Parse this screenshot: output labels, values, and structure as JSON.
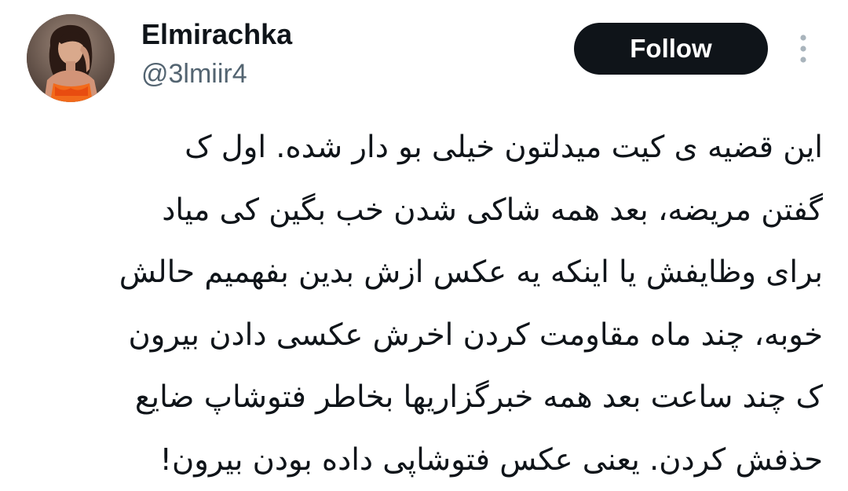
{
  "author": {
    "display_name": "Elmirachka",
    "handle": "@3lmiir4"
  },
  "actions": {
    "follow_label": "Follow",
    "more_icon": "more-vertical-icon"
  },
  "tweet": {
    "lines": [
      "این قضیه ی کیت میدلتون خیلی بو دار شده. اول ک",
      "گفتن مریضه، بعد همه شاکی شدن خب بگین کی میاد",
      "برای وظایفش یا اینکه یه عکس ازش بدین بفهمیم حالش",
      "خوبه، چند ماه مقاومت کردن اخرش عکسی دادن بیرون",
      "ک چند ساعت بعد همه خبرگزاریها بخاطر فتوشاپ ضایع",
      "حذفش کردن. یعنی عکس فتوشاپی داده بودن بیرون!"
    ]
  },
  "colors": {
    "text_primary": "#0f1419",
    "text_secondary": "#536471",
    "button_bg": "#0f1419",
    "button_text": "#ffffff"
  }
}
